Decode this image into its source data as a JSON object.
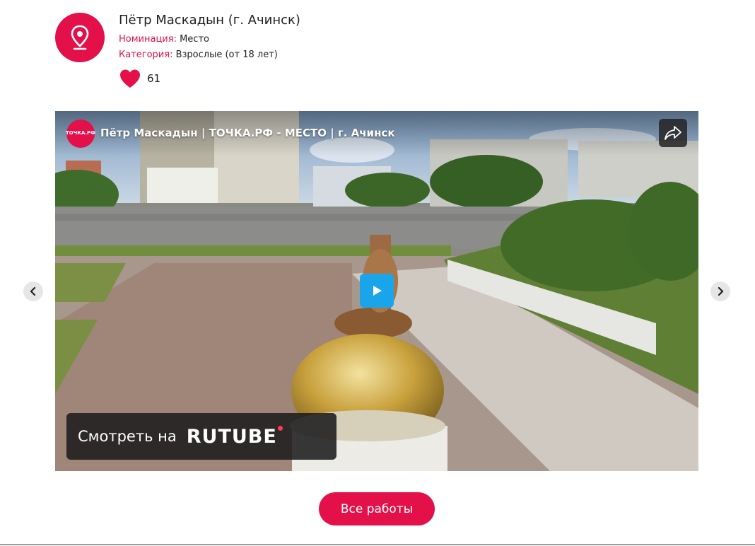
{
  "entry": {
    "title": "Пётр Маскадын (г. Ачинск)",
    "nomination_label": "Номинация:",
    "nomination_value": "Место",
    "category_label": "Категория:",
    "category_value": "Взрослые (от 18 лет)",
    "likes": "61",
    "avatar_icon": "map-pin-icon"
  },
  "player": {
    "channel_logo_text": "ТОЧКА.РФ",
    "video_title": "Пётр Маскадын | ТОЧКА.РФ - МЕСТО | г. Ачинск",
    "share_icon": "share-arrow-icon",
    "play_icon": "play-icon",
    "watch_on_label": "Смотреть на",
    "watch_on_brand": "RUTUBE"
  },
  "carousel": {
    "prev_icon": "chevron-left-icon",
    "next_icon": "chevron-right-icon"
  },
  "actions": {
    "all_works": "Все работы"
  },
  "colors": {
    "brand": "#e3104a",
    "play": "#1aa5ea"
  }
}
